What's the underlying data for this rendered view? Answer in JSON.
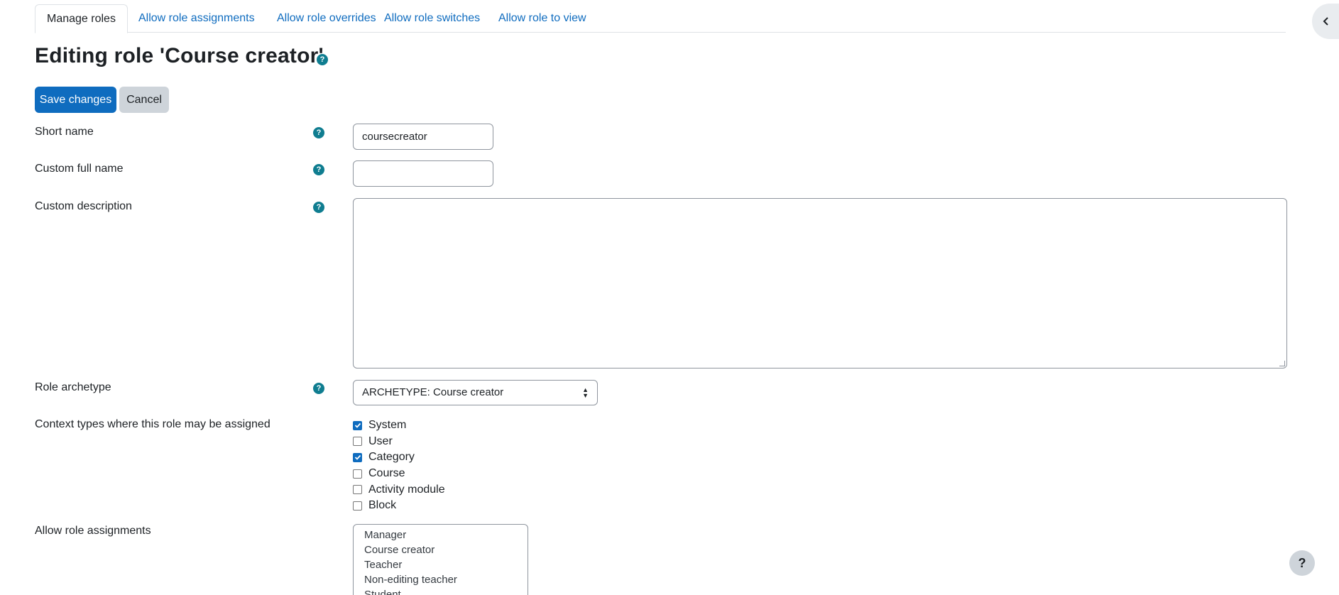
{
  "tabs": [
    {
      "label": "Manage roles",
      "active": true
    },
    {
      "label": "Allow role assignments",
      "active": false
    },
    {
      "label": "Allow role overrides",
      "active": false
    },
    {
      "label": "Allow role switches",
      "active": false
    },
    {
      "label": "Allow role to view",
      "active": false
    }
  ],
  "page": {
    "title": "Editing role 'Course creator'",
    "help_icon": "question-mark-icon"
  },
  "buttons": {
    "save": "Save changes",
    "cancel": "Cancel"
  },
  "form": {
    "short_name": {
      "label": "Short name",
      "value": "coursecreator"
    },
    "custom_full_name": {
      "label": "Custom full name",
      "value": ""
    },
    "custom_description": {
      "label": "Custom description",
      "value": ""
    },
    "role_archetype": {
      "label": "Role archetype",
      "selected": "ARCHETYPE: Course creator"
    },
    "context_types": {
      "label": "Context types where this role may be assigned",
      "options": [
        {
          "label": "System",
          "checked": true
        },
        {
          "label": "User",
          "checked": false
        },
        {
          "label": "Category",
          "checked": true
        },
        {
          "label": "Course",
          "checked": false
        },
        {
          "label": "Activity module",
          "checked": false
        },
        {
          "label": "Block",
          "checked": false
        }
      ]
    },
    "allow_role_assignments": {
      "label": "Allow role assignments",
      "options": [
        "Manager",
        "Course creator",
        "Teacher",
        "Non-editing teacher",
        "Student"
      ]
    }
  },
  "colors": {
    "primary": "#0f6cbf",
    "help_icon": "#0f7d90",
    "secondary_button": "#ced4da"
  },
  "floating_help": "?"
}
